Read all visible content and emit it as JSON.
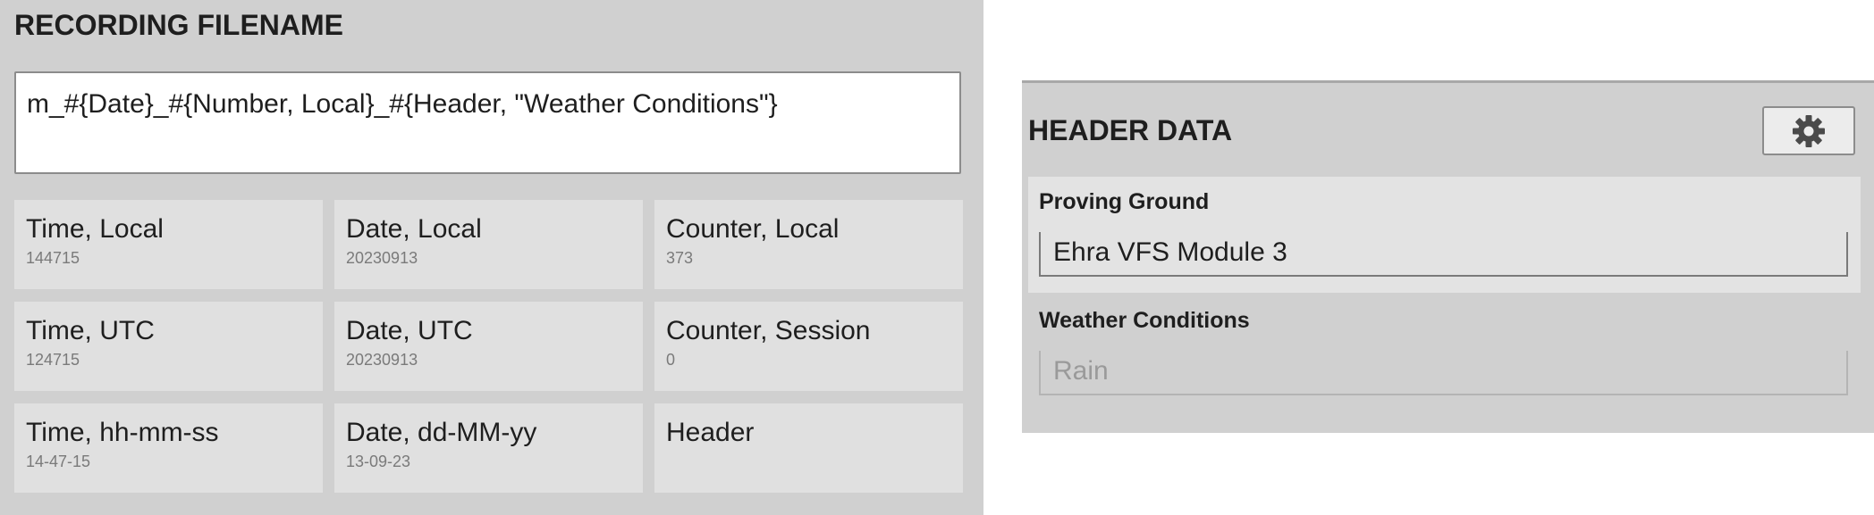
{
  "recording_filename": {
    "title": "RECORDING FILENAME",
    "value": "m_#{Date}_#{Number, Local}_#{Header, \"Weather Conditions\"}",
    "tiles": [
      {
        "label": "Time, Local",
        "value": "144715"
      },
      {
        "label": "Date, Local",
        "value": "20230913"
      },
      {
        "label": "Counter, Local",
        "value": "373"
      },
      {
        "label": "Time, UTC",
        "value": "124715"
      },
      {
        "label": "Date, UTC",
        "value": "20230913"
      },
      {
        "label": "Counter, Session",
        "value": "0"
      },
      {
        "label": "Time, hh-mm-ss",
        "value": "14-47-15"
      },
      {
        "label": "Date, dd-MM-yy",
        "value": "13-09-23"
      },
      {
        "label": "Header",
        "value": ""
      }
    ]
  },
  "header_data": {
    "title": "HEADER DATA",
    "settings_icon": "gear-icon",
    "fields": [
      {
        "label": "Proving Ground",
        "value": "Ehra VFS Module 3"
      },
      {
        "label": "Weather Conditions",
        "value": "Rain"
      }
    ]
  }
}
